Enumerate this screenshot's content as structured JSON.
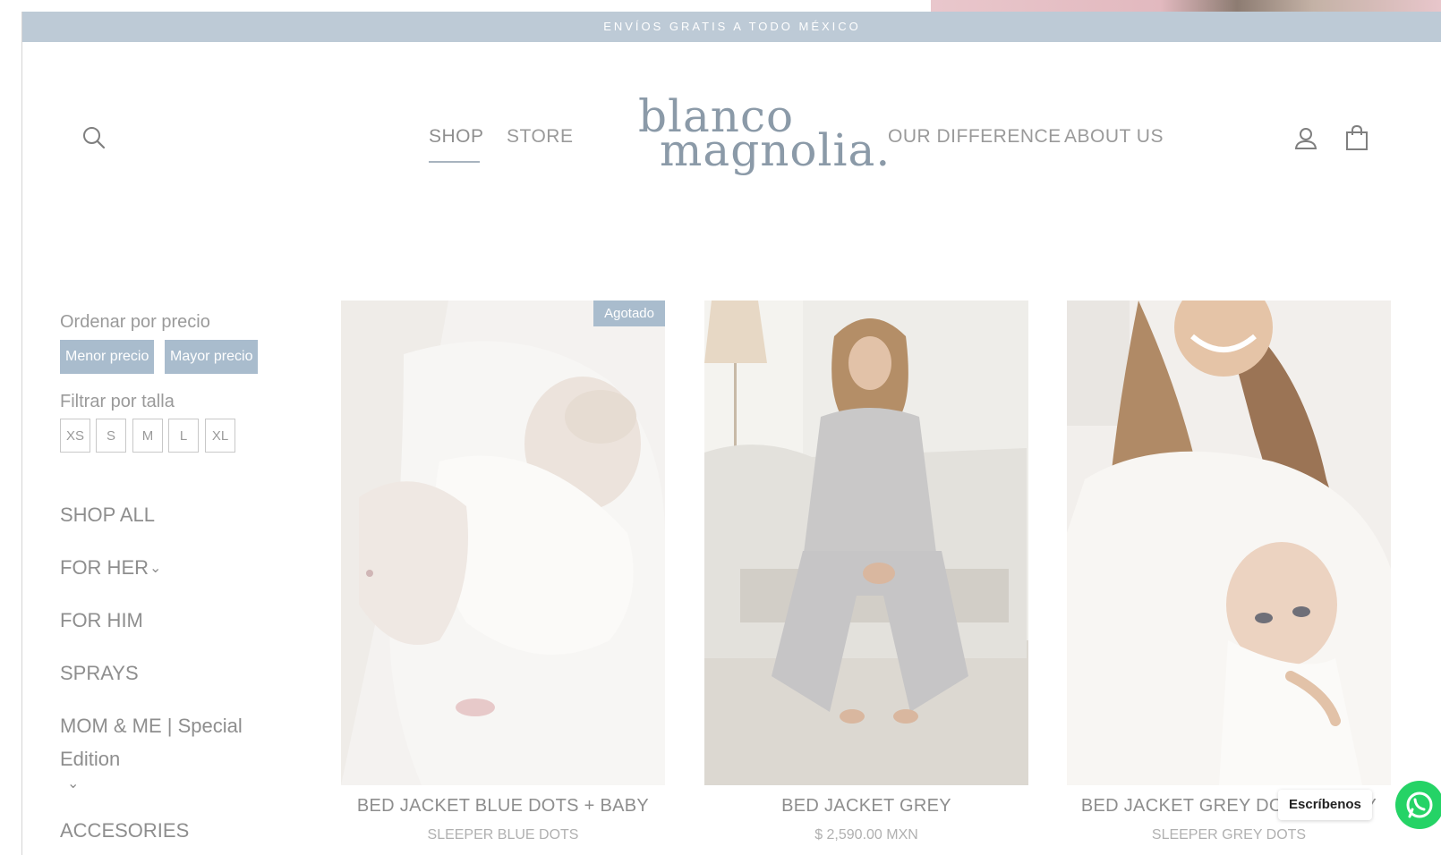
{
  "announcement": {
    "text": "ENVÍOS GRATIS A TODO MÉXICO"
  },
  "header": {
    "nav_left": [
      {
        "label": "SHOP",
        "active": true
      },
      {
        "label": "STORE",
        "active": false
      }
    ],
    "logo": {
      "line1": "blanco",
      "line2": "magnolia."
    },
    "nav_right": [
      {
        "label": "OUR DIFFERENCE"
      },
      {
        "label": "ABOUT US"
      }
    ],
    "icons": [
      "search-icon",
      "account-icon",
      "cart-icon"
    ]
  },
  "filters": {
    "sort_label": "Ordenar por precio",
    "sort_options": [
      "Menor precio",
      "Mayor precio"
    ],
    "size_label": "Filtrar por talla",
    "sizes": [
      "XS",
      "S",
      "M",
      "L",
      "XL"
    ]
  },
  "categories": [
    {
      "label": "SHOP ALL"
    },
    {
      "label": "FOR HER"
    },
    {
      "label": "FOR HIM"
    },
    {
      "label": "SPRAYS"
    },
    {
      "label": "MOM & ME | Special"
    },
    {
      "label": "Edition"
    },
    {
      "label": "ACCESORIES"
    }
  ],
  "products": [
    {
      "title": "BED JACKET BLUE DOTS + BABY",
      "subtitle": "SLEEPER BLUE DOTS",
      "badge": "Agotado"
    },
    {
      "title": "BED JACKET GREY",
      "subtitle": "$ 2,590.00 MXN",
      "badge": ""
    },
    {
      "title": "BED JACKET GREY DOTS + BABY",
      "subtitle": "SLEEPER GREY DOTS",
      "badge": ""
    }
  ],
  "chat": {
    "label": "Escríbenos"
  },
  "colors": {
    "announcement_bg": "#bdcad6",
    "accent": "#a9bccd",
    "logo": "#8b9aa8",
    "whatsapp": "#25d366"
  }
}
